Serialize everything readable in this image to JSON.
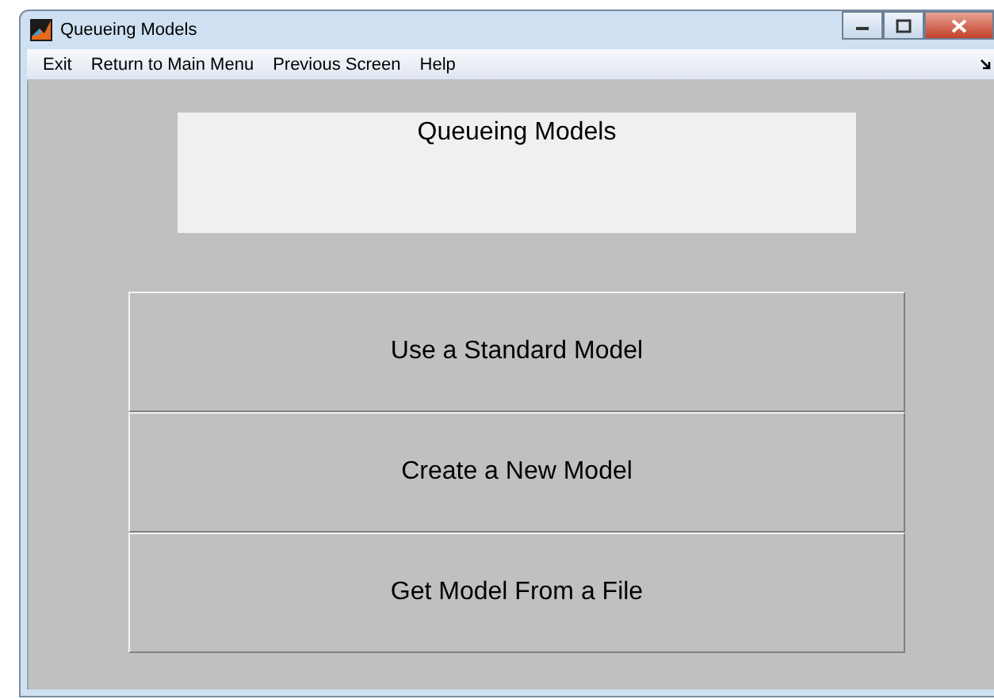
{
  "window": {
    "title": "Queueing Models"
  },
  "menu": [
    "Exit",
    "Return to Main Menu",
    "Previous Screen",
    "Help"
  ],
  "header": {
    "title": "Queueing Models"
  },
  "buttons": [
    "Use a Standard Model",
    "Create a New Model",
    "Get Model From a File"
  ]
}
